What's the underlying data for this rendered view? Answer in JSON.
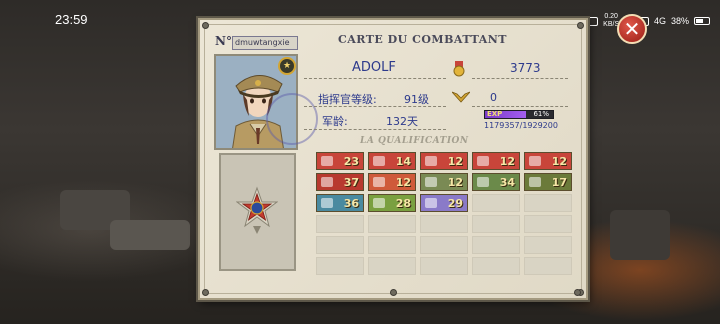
{
  "status_bar": {
    "time": "23:59",
    "speed_top": "0.20",
    "speed_unit": "KB/S",
    "network": "4G",
    "battery": "38%"
  },
  "card": {
    "no_label": "N°",
    "username": "dmuwtangxie",
    "title": "CARTE DU COMBATTANT",
    "name": "ADOLF",
    "medal_count": "3773",
    "level_label": "指挥官等级:",
    "level_value": "91级",
    "rank_value": "0",
    "exp_label": "EXP",
    "exp_percent": "61%",
    "exp_fraction": 0.61,
    "exp_text": "1179357/1929200",
    "age_label": "军龄:",
    "age_value": "132天",
    "qualification_title": "LA QUALIFICATION"
  },
  "qualifications": [
    {
      "value": "23",
      "color": "#c8453a",
      "icon": "bazooka-icon"
    },
    {
      "value": "14",
      "color": "#c8453a",
      "icon": "grenade-icon"
    },
    {
      "value": "12",
      "color": "#c8453a",
      "icon": "rocket-icon"
    },
    {
      "value": "12",
      "color": "#c8453a",
      "icon": "rifle-icon"
    },
    {
      "value": "12",
      "color": "#c8453a",
      "icon": "flamethrower-icon"
    },
    {
      "value": "37",
      "color": "#b8392f",
      "icon": "shotgun-icon"
    },
    {
      "value": "12",
      "color": "#cf5a3a",
      "icon": "shell-icon"
    },
    {
      "value": "12",
      "color": "#7a8a54",
      "icon": "tank-icon"
    },
    {
      "value": "34",
      "color": "#6b8a4a",
      "icon": "armor-icon"
    },
    {
      "value": "17",
      "color": "#6b7a3a",
      "icon": "truck-icon"
    },
    {
      "value": "36",
      "color": "#4a8aa0",
      "icon": "vehicle-icon"
    },
    {
      "value": "28",
      "color": "#7aa040",
      "icon": "supply-icon"
    },
    {
      "value": "29",
      "color": "#8a7ac8",
      "icon": "trophy-icon"
    }
  ]
}
